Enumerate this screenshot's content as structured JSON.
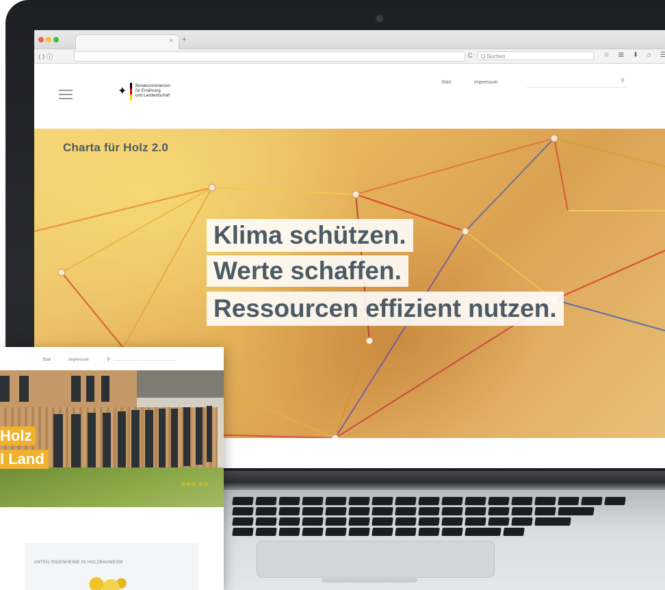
{
  "browser": {
    "search_placeholder": "Q Suchen",
    "tab_close": "×",
    "new_tab": "+",
    "nav_back_forward": "⟨ ⟩ ⓘ",
    "reload": "C",
    "toolbar_icons": "☆ ⊞ ⬇ ⌂ ☰"
  },
  "site": {
    "ministry_name_line1": "Bundesministerium",
    "ministry_name_line2": "für Ernährung",
    "ministry_name_line3": "und Landwirtschaft",
    "nav": {
      "start": "Start",
      "impressum": "Impressum"
    },
    "search_icon": "⚲",
    "hero": {
      "section_title": "Charta für Holz 2.0",
      "headline_1": "Klima schützen.",
      "headline_2": "Werte schaffen.",
      "headline_3": "Ressourcen effizient nutzen."
    }
  },
  "tablet": {
    "nav": {
      "start": "Start",
      "impressum": "Impressum"
    },
    "search_icon": "⚲",
    "tag_line_1": "Holz",
    "tag_line_2": "l Land",
    "card_title": "ANTEIL EIGENHEIME IN HOLZBAUWEISE",
    "sunflowers": "✿✿✿ ✿✿"
  },
  "colors": {
    "headline_text": "#4b5a64",
    "tag_background": "#f1b12c",
    "hero_wood": "#e7b65c"
  }
}
